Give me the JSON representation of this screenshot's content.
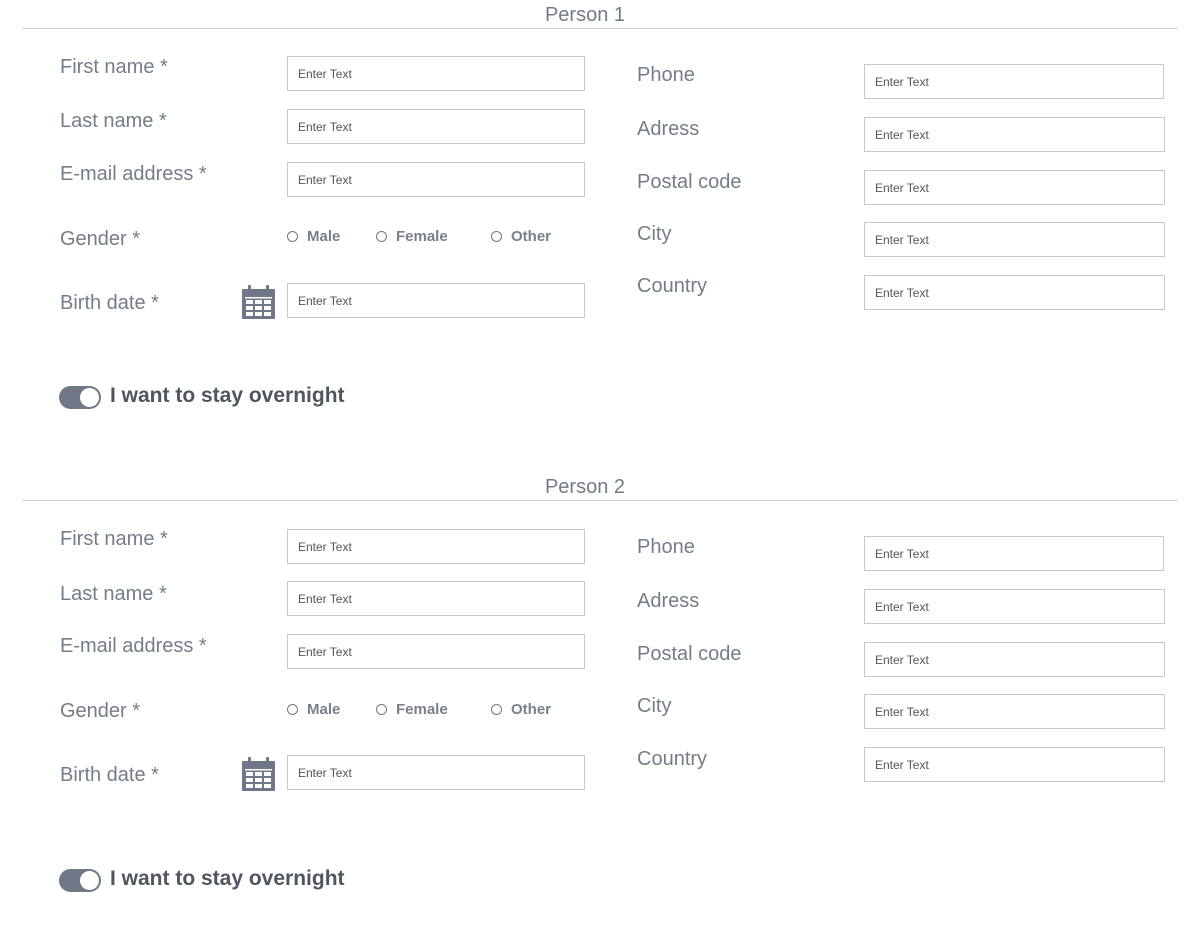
{
  "colors": {
    "label": "#757d88",
    "toggle": "#707787",
    "divider": "#c9ccd0"
  },
  "persons": [
    {
      "title": "Person 1",
      "left": {
        "first_name": {
          "label": "First name *",
          "placeholder": "Enter Text"
        },
        "last_name": {
          "label": "Last name *",
          "placeholder": "Enter Text"
        },
        "email": {
          "label": "E-mail address *",
          "placeholder": "Enter Text"
        },
        "gender": {
          "label": "Gender *",
          "options": [
            "Male",
            "Female",
            "Other"
          ]
        },
        "birth_date": {
          "label": "Birth date *",
          "placeholder": "Enter Text",
          "icon": "calendar-icon"
        }
      },
      "right": {
        "phone": {
          "label": "Phone",
          "placeholder": "Enter Text"
        },
        "address": {
          "label": "Adress",
          "placeholder": "Enter Text"
        },
        "postal_code": {
          "label": "Postal code",
          "placeholder": "Enter Text"
        },
        "city": {
          "label": "City",
          "placeholder": "Enter Text"
        },
        "country": {
          "label": "Country",
          "placeholder": "Enter Text"
        }
      },
      "overnight": {
        "label": "I want to stay overnight",
        "on": true
      }
    },
    {
      "title": "Person 2",
      "left": {
        "first_name": {
          "label": "First name *",
          "placeholder": "Enter Text"
        },
        "last_name": {
          "label": "Last name *",
          "placeholder": "Enter Text"
        },
        "email": {
          "label": "E-mail address *",
          "placeholder": "Enter Text"
        },
        "gender": {
          "label": "Gender *",
          "options": [
            "Male",
            "Female",
            "Other"
          ]
        },
        "birth_date": {
          "label": "Birth date *",
          "placeholder": "Enter Text",
          "icon": "calendar-icon"
        }
      },
      "right": {
        "phone": {
          "label": "Phone",
          "placeholder": "Enter Text"
        },
        "address": {
          "label": "Adress",
          "placeholder": "Enter Text"
        },
        "postal_code": {
          "label": "Postal code",
          "placeholder": "Enter Text"
        },
        "city": {
          "label": "City",
          "placeholder": "Enter Text"
        },
        "country": {
          "label": "Country",
          "placeholder": "Enter Text"
        }
      },
      "overnight": {
        "label": "I want to stay overnight",
        "on": true
      }
    }
  ]
}
